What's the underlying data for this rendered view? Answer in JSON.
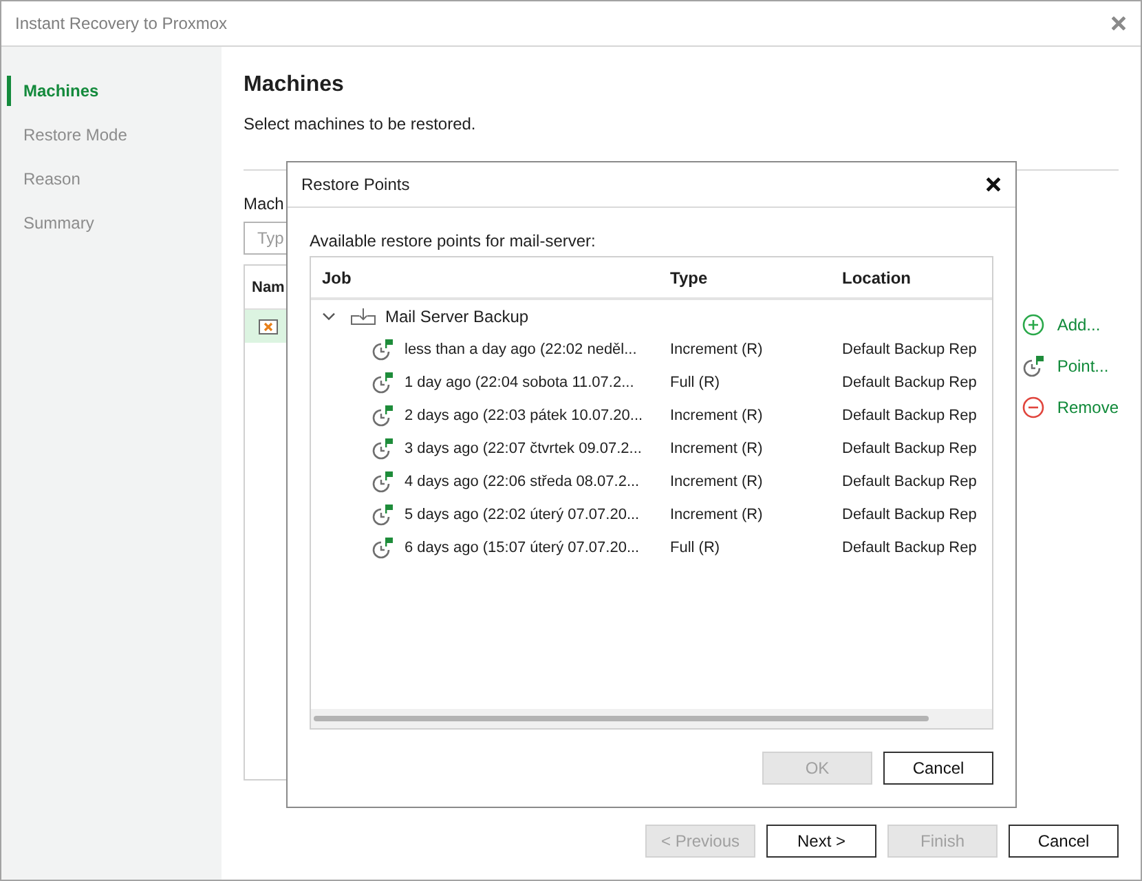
{
  "window": {
    "title": "Instant Recovery to Proxmox"
  },
  "sidebar": {
    "items": [
      {
        "label": "Machines",
        "selected": true
      },
      {
        "label": "Restore Mode",
        "selected": false
      },
      {
        "label": "Reason",
        "selected": false
      },
      {
        "label": "Summary",
        "selected": false
      }
    ]
  },
  "page": {
    "heading": "Machines",
    "description": "Select machines to be restored.",
    "list_label": "Mach",
    "search": {
      "placeholder": "Typ"
    },
    "table": {
      "columns": [
        "Nam"
      ],
      "rows": [
        {
          "selected": true
        }
      ]
    },
    "actions": [
      {
        "kind": "add",
        "label": "Add..."
      },
      {
        "kind": "point",
        "label": "Point..."
      },
      {
        "kind": "remove",
        "label": "Remove"
      }
    ]
  },
  "dialog": {
    "title": "Restore Points",
    "prompt": "Available restore points for mail-server:",
    "columns": [
      "Job",
      "Type",
      "Location"
    ],
    "jobs": [
      {
        "label": "Mail Server Backup",
        "expanded": true,
        "children": [
          {
            "job": "less than a day ago (22:02 neděl...",
            "type": "Increment (R)",
            "location": "Default Backup Rep",
            "selected": false
          },
          {
            "job": "1 day ago (22:04 sobota 11.07.2...",
            "type": "Full (R)",
            "location": "Default Backup Rep",
            "selected": false
          },
          {
            "job": "2 days ago (22:03 pátek 10.07.20...",
            "type": "Increment (R)",
            "location": "Default Backup Rep",
            "selected": false
          },
          {
            "job": "3 days ago (22:07 čtvrtek 09.07.2...",
            "type": "Increment (R)",
            "location": "Default Backup Rep",
            "selected": false
          },
          {
            "job": "4 days ago (22:06 středa 08.07.2...",
            "type": "Increment (R)",
            "location": "Default Backup Rep",
            "selected": false
          },
          {
            "job": "5 days ago (22:02 úterý 07.07.20...",
            "type": "Increment (R)",
            "location": "Default Backup Rep",
            "selected": false
          },
          {
            "job": "6 days ago (15:07 úterý 07.07.20...",
            "type": "Full (R)",
            "location": "Default Backup Rep",
            "selected": false
          }
        ]
      }
    ],
    "buttons": [
      {
        "label": "OK",
        "disabled": true
      },
      {
        "label": "Cancel",
        "disabled": false
      }
    ]
  },
  "wizard_buttons": [
    {
      "label": "< Previous",
      "disabled": true
    },
    {
      "label": "Next >",
      "disabled": false
    },
    {
      "label": "Finish",
      "disabled": true
    },
    {
      "label": "Cancel",
      "disabled": false
    }
  ]
}
